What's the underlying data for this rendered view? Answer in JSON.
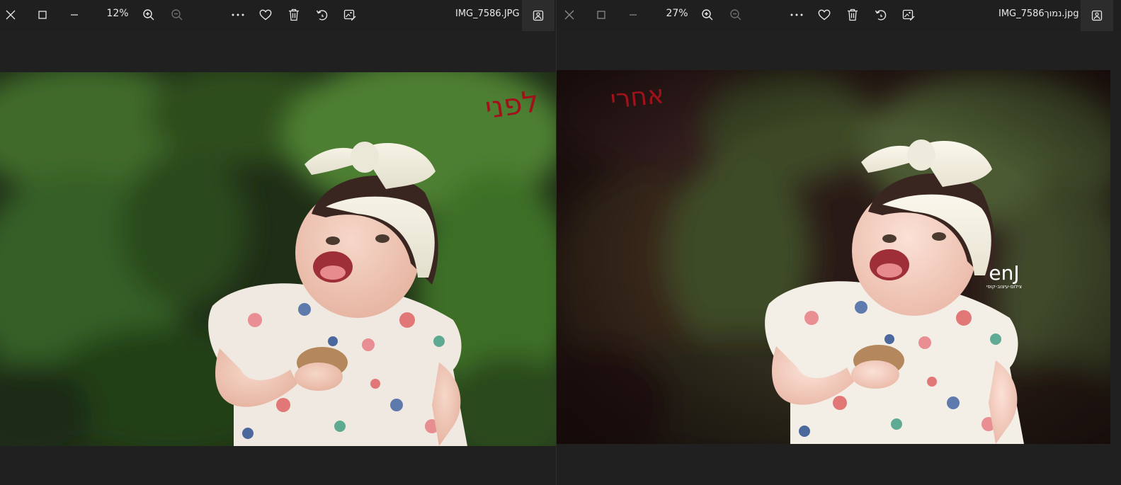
{
  "viewers": {
    "left": {
      "zoom": "12%",
      "file_name": "IMG_7586.JPG",
      "annotation": "לפני",
      "watermark_logo": "",
      "watermark_tagline": ""
    },
    "right": {
      "zoom": "27%",
      "file_name": "IMG_7586נמוך.jpg",
      "annotation": "אחרי",
      "watermark_logo": "enJ",
      "watermark_tagline": "צילום-עיצוב-קופי"
    }
  },
  "icons": {
    "close": "close-icon",
    "maximize": "maximize-icon",
    "minimize": "minimize-icon",
    "zoom_in": "zoom-in-icon",
    "zoom_out": "zoom-out-icon",
    "more": "more-icon",
    "favorite": "heart-icon",
    "delete": "trash-icon",
    "rotate": "rotate-icon",
    "edit": "edit-image-icon",
    "info": "image-info-icon"
  },
  "colors": {
    "toolbar_bg": "#1f1f1f",
    "canvas_bg": "#202020",
    "icon": "#e6e6e6",
    "icon_disabled": "#6e6e6e",
    "annotation": "#a0121a"
  }
}
